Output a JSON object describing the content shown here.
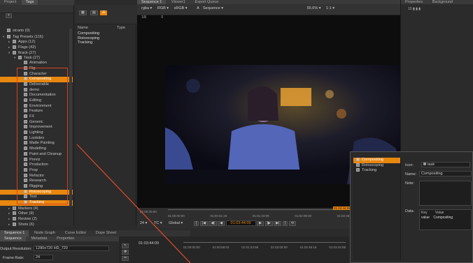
{
  "top_tabs": [
    "Project",
    "Tags"
  ],
  "viewer_tabs": [
    "Sequence 1",
    "Viewer1",
    "Export Queue"
  ],
  "right_tabs": [
    "Properties",
    "Background"
  ],
  "viewer_toolbar": {
    "channel": "rgba",
    "colorspace": "RGB",
    "lut": "sRGB",
    "view_mode": "A",
    "sequence": "Sequence",
    "zoom": "55.6%",
    "ratio": "1:1",
    "frame": "1/8",
    "frame_start": "0"
  },
  "tree": [
    {
      "label": "sicario (0)",
      "indent": 0,
      "tri": ""
    },
    {
      "label": "Tag Presets (116)",
      "indent": 0,
      "tri": "▾"
    },
    {
      "label": "Apps (12)",
      "indent": 1,
      "tri": "▸"
    },
    {
      "label": "Flags (42)",
      "indent": 1,
      "tri": "▸"
    },
    {
      "label": "ftrack (27)",
      "indent": 1,
      "tri": "▾"
    },
    {
      "label": "Task (27)",
      "indent": 2,
      "tri": "▾"
    },
    {
      "label": "Animation",
      "indent": 3,
      "tri": ""
    },
    {
      "label": "Rig",
      "indent": 3,
      "tri": ""
    },
    {
      "label": "Character",
      "indent": 3,
      "tri": ""
    },
    {
      "label": "Compositing",
      "indent": 3,
      "tri": "",
      "selected": true
    },
    {
      "label": "Deliverable",
      "indent": 3,
      "tri": ""
    },
    {
      "label": "demo",
      "indent": 3,
      "tri": ""
    },
    {
      "label": "Documentation",
      "indent": 3,
      "tri": ""
    },
    {
      "label": "Editing",
      "indent": 3,
      "tri": ""
    },
    {
      "label": "Environment",
      "indent": 3,
      "tri": ""
    },
    {
      "label": "Feature",
      "indent": 3,
      "tri": ""
    },
    {
      "label": "FX",
      "indent": 3,
      "tri": ""
    },
    {
      "label": "Generic",
      "indent": 3,
      "tri": ""
    },
    {
      "label": "Improvement",
      "indent": 3,
      "tri": ""
    },
    {
      "label": "Lighting",
      "indent": 3,
      "tri": ""
    },
    {
      "label": "Lookdev",
      "indent": 3,
      "tri": ""
    },
    {
      "label": "Matte Painting",
      "indent": 3,
      "tri": ""
    },
    {
      "label": "Modelling",
      "indent": 3,
      "tri": ""
    },
    {
      "label": "Paint and Cleanup",
      "indent": 3,
      "tri": ""
    },
    {
      "label": "Previz",
      "indent": 3,
      "tri": ""
    },
    {
      "label": "Production",
      "indent": 3,
      "tri": ""
    },
    {
      "label": "Prop",
      "indent": 3,
      "tri": ""
    },
    {
      "label": "Refactor",
      "indent": 3,
      "tri": ""
    },
    {
      "label": "Research",
      "indent": 3,
      "tri": ""
    },
    {
      "label": "Rigging",
      "indent": 3,
      "tri": ""
    },
    {
      "label": "Rotoscoping",
      "indent": 3,
      "tri": "",
      "selected": true
    },
    {
      "label": "Test",
      "indent": 3,
      "tri": ""
    },
    {
      "label": "Tracking",
      "indent": 3,
      "tri": "",
      "selected": true
    },
    {
      "label": "Markers (4)",
      "indent": 1,
      "tri": "▸"
    },
    {
      "label": "Other (9)",
      "indent": 1,
      "tri": "▸"
    },
    {
      "label": "Review (2)",
      "indent": 1,
      "tri": "▸"
    },
    {
      "label": "Shots (6)",
      "indent": 1,
      "tri": "▸"
    }
  ],
  "mid_list": {
    "col_name": "Name",
    "col_type": "Type",
    "items": [
      "Compositing",
      "Rotoscoping",
      "Tracking"
    ]
  },
  "timeline": {
    "timecode": "01:03:44:09",
    "start": "01:00:00:00",
    "ticks": [
      "01:00:00:00",
      "01:00:41:16",
      "01:01:23:08",
      "01:02:05:00",
      "01:02:46:16",
      "01:03:28:08"
    ],
    "current_marker": "01:03:44:09",
    "fps": "24",
    "tc_label": "TC",
    "global_label": "Global",
    "tc_small": [
      "01:00:00:00"
    ]
  },
  "popup": {
    "list": [
      "Compositing",
      "Rotoscoping",
      "Tracking"
    ],
    "icon_label": "Icon:",
    "icon_value": "task",
    "name_label": "Name:",
    "name_value": "Compositing",
    "note_label": "Note:",
    "data_label": "Data:",
    "key_col": "Key",
    "value_col": "Value",
    "row_key": "value",
    "row_value": "Compositing"
  },
  "bottom_tabs": [
    "Sequence 1",
    "Node Graph",
    "Curve Editor",
    "Dope Sheet"
  ],
  "bottom_sub_tabs": [
    "Sequence",
    "Metadata",
    "Properties"
  ],
  "bottom_fields": {
    "output_label": "Output Resolution:",
    "output_value": "1280x720 HD_720",
    "framerate_label": "Frame Rate:",
    "framerate_value": "24"
  },
  "bottom_timeline": {
    "timecode": "01:03:44:09",
    "ticks": [
      "01:00:00:00",
      "01:00:58:03",
      "01:01:23:08",
      "01:02:05:00",
      "01:02:46:16",
      "01:03:44:09"
    ]
  },
  "colors": {
    "accent": "#e8870f",
    "selection_outline": "#d9401e",
    "annotation_line": "#e24a2a"
  }
}
